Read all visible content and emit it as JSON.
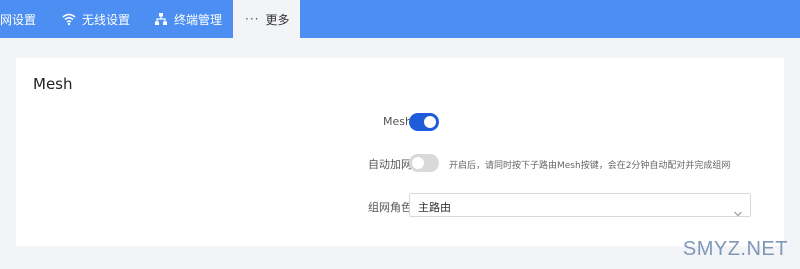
{
  "nav": {
    "items": [
      {
        "label": "网设置",
        "icon": "none"
      },
      {
        "label": "无线设置",
        "icon": "wifi-icon"
      },
      {
        "label": "终端管理",
        "icon": "network-tree-icon"
      },
      {
        "label": "更多",
        "icon": "more-dots-icon"
      }
    ],
    "more_dots": "···",
    "active_index": 3
  },
  "card": {
    "title": "Mesh",
    "fields": {
      "mesh_label": "Mesh",
      "mesh_enabled": true,
      "auto_join_label": "自动加网",
      "auto_join_enabled": false,
      "auto_join_hint": "开启后，请同时按下子路由Mesh按键，会在2分钟自动配对并完成组网",
      "role_label": "组网角色",
      "role_value": "主路由"
    }
  },
  "watermark": "SMYZ.NET",
  "colors": {
    "nav_bg": "#4c8ef2",
    "toggle_on": "#1f5cd9",
    "toggle_off": "#d9d9d9",
    "page_bg": "#f2f4f7"
  }
}
